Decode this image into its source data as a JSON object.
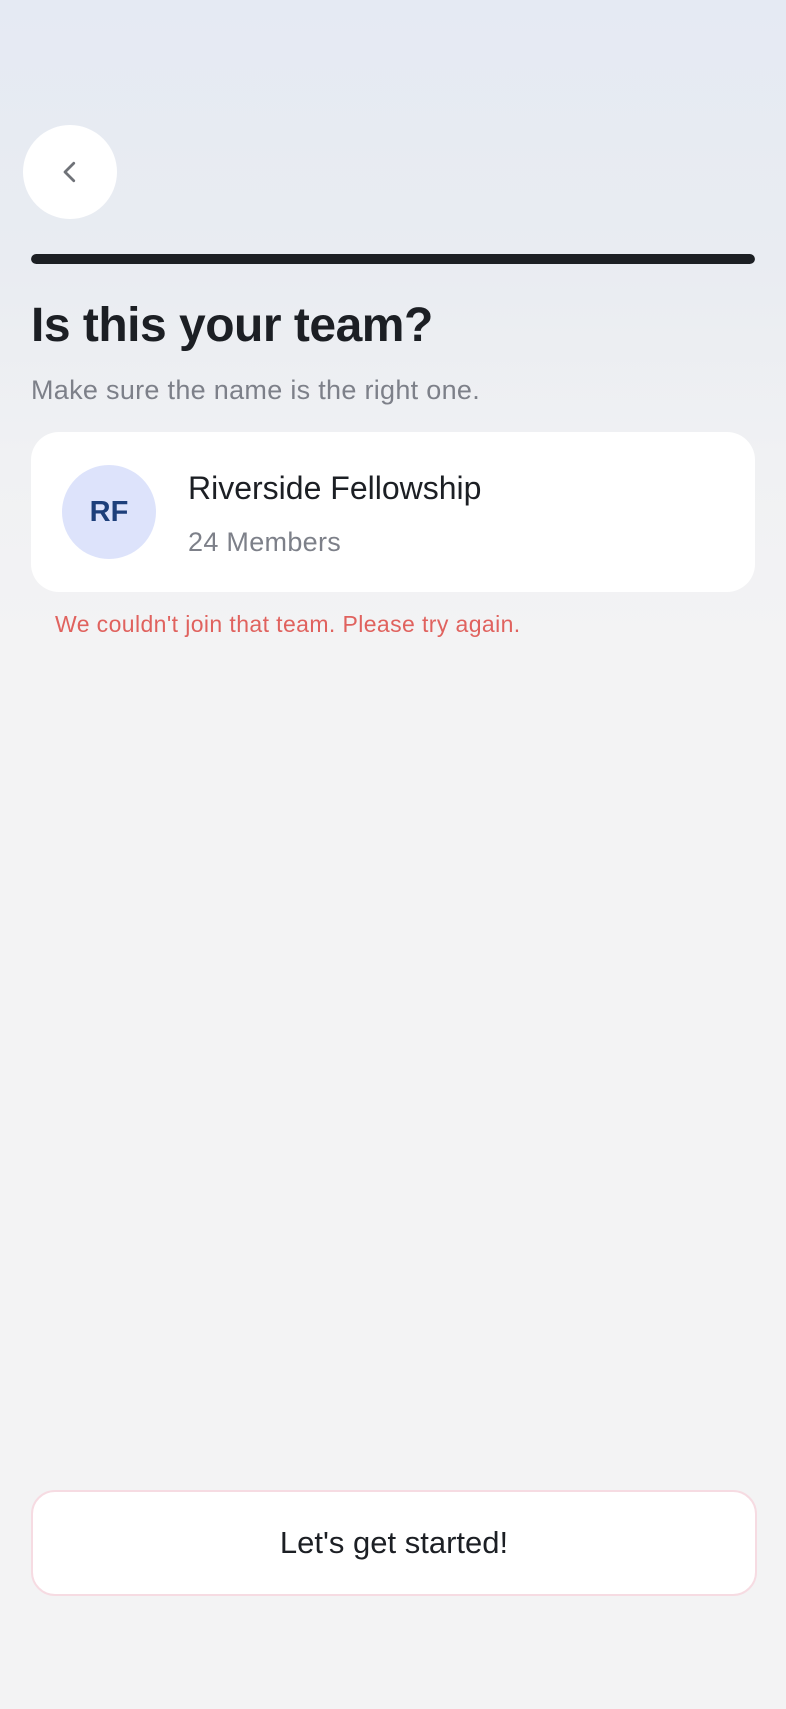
{
  "header": {
    "back_icon": "chevron-left-icon",
    "progress": 1.0
  },
  "main": {
    "title": "Is this your team?",
    "subtitle": "Make sure the name is the right one."
  },
  "team_card": {
    "initials": "RF",
    "name": "Riverside Fellowship",
    "members": "24 Members"
  },
  "error": {
    "message": "We couldn't join that team. Please try again."
  },
  "footer": {
    "cta_label": "Let's get started!"
  },
  "colors": {
    "accent_dark": "#1c1f24",
    "error": "#e0625e",
    "avatar_bg": "#dde3fb",
    "avatar_text": "#1d3f7a",
    "muted_text": "#7d8089"
  }
}
